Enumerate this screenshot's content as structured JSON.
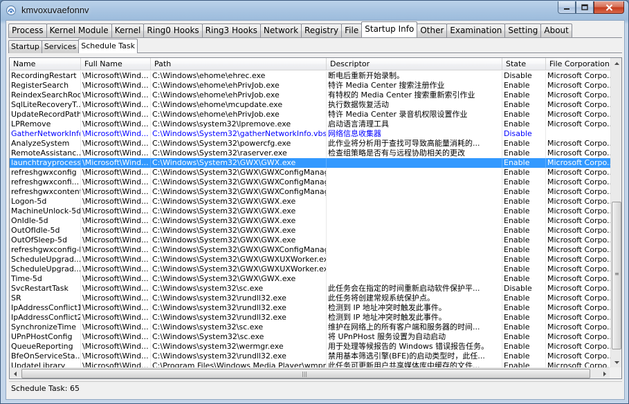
{
  "window": {
    "title": "kmvoxuvaefonnv"
  },
  "main_tabs": [
    {
      "label": "Process",
      "active": false
    },
    {
      "label": "Kernel Module",
      "active": false
    },
    {
      "label": "Kernel",
      "active": false
    },
    {
      "label": "Ring0 Hooks",
      "active": false
    },
    {
      "label": "Ring3 Hooks",
      "active": false
    },
    {
      "label": "Network",
      "active": false
    },
    {
      "label": "Registry",
      "active": false
    },
    {
      "label": "File",
      "active": false
    },
    {
      "label": "Startup Info",
      "active": true
    },
    {
      "label": "Other",
      "active": false
    },
    {
      "label": "Examination",
      "active": false
    },
    {
      "label": "Setting",
      "active": false
    },
    {
      "label": "About",
      "active": false
    }
  ],
  "sub_tabs": [
    {
      "label": "Startup",
      "active": false
    },
    {
      "label": "Services",
      "active": false
    },
    {
      "label": "Schedule Task",
      "active": true
    }
  ],
  "table": {
    "columns": [
      "Name",
      "Full Name",
      "Path",
      "Descriptor",
      "State",
      "File Corporation"
    ],
    "rows": [
      [
        "RecordingRestart",
        "\\Microsoft\\Wind...",
        "C:\\Windows\\ehome\\ehrec.exe",
        "断电后重新开始录制。",
        "Disable",
        "Microsoft Corpo..."
      ],
      [
        "RegisterSearch",
        "\\Microsoft\\Wind...",
        "C:\\Windows\\ehome\\ehPrivJob.exe",
        "特许 Media Center 搜索注册作业",
        "Enable",
        "Microsoft Corpo..."
      ],
      [
        "ReindexSearchRoot",
        "\\Microsoft\\Wind...",
        "C:\\Windows\\ehome\\ehPrivJob.exe",
        "有特权的 Media Center 搜索重新索引作业",
        "Enable",
        "Microsoft Corpo..."
      ],
      [
        "SqlLiteRecoveryT...",
        "\\Microsoft\\Wind...",
        "C:\\Windows\\ehome\\mcupdate.exe",
        "执行数据恢复活动",
        "Enable",
        "Microsoft Corpo..."
      ],
      [
        "UpdateRecordPath",
        "\\Microsoft\\Wind...",
        "C:\\Windows\\ehome\\ehPrivJob.exe",
        "特许 Media Center 录音机权限设置作业",
        "Enable",
        "Microsoft Corpo..."
      ],
      [
        "LPRemove",
        "\\Microsoft\\Wind...",
        "C:\\Windows\\system32\\lpremove.exe",
        "启动语言清理工具",
        "Enable",
        "Microsoft Corpo..."
      ],
      [
        "GatherNetworkInfo",
        "\\Microsoft\\Wind...",
        "C:\\Windows\\System32\\gatherNetworkInfo.vbs",
        "网络信息收集器",
        "Disable",
        ""
      ],
      [
        "AnalyzeSystem",
        "\\Microsoft\\Wind...",
        "C:\\Windows\\System32\\powercfg.exe",
        "此作业将分析用于查找可导致高能量消耗的...",
        "Enable",
        "Microsoft Corpo..."
      ],
      [
        "RemoteAssistanc...",
        "\\Microsoft\\Wind...",
        "C:\\Windows\\System32\\raserver.exe",
        "检查组策略是否有与远程协助相关的更改",
        "Enable",
        "Microsoft Corpo..."
      ],
      [
        "launchtrayprocess",
        "\\Microsoft\\Wind...",
        "C:\\Windows\\System32\\GWX\\GWX.exe",
        "",
        "Enable",
        "Microsoft Corpo..."
      ],
      [
        "refreshgwxconfig",
        "\\Microsoft\\Wind...",
        "C:\\Windows\\System32\\GWX\\GWXConfigManag...",
        "",
        "Enable",
        "Microsoft Corpo..."
      ],
      [
        "refreshgwxconfi...",
        "\\Microsoft\\Wind...",
        "C:\\Windows\\System32\\GWX\\GWXConfigManag...",
        "",
        "Enable",
        "Microsoft Corpo..."
      ],
      [
        "refreshgwxcontent",
        "\\Microsoft\\Wind...",
        "C:\\Windows\\System32\\GWX\\GWXConfigManag...",
        "",
        "Enable",
        "Microsoft Corpo..."
      ],
      [
        "Logon-5d",
        "\\Microsoft\\Wind...",
        "C:\\Windows\\System32\\GWX\\GWX.exe",
        "",
        "Enable",
        "Microsoft Corpo..."
      ],
      [
        "MachineUnlock-5d",
        "\\Microsoft\\Wind...",
        "C:\\Windows\\System32\\GWX\\GWX.exe",
        "",
        "Enable",
        "Microsoft Corpo..."
      ],
      [
        "OnIdle-5d",
        "\\Microsoft\\Wind...",
        "C:\\Windows\\System32\\GWX\\GWX.exe",
        "",
        "Enable",
        "Microsoft Corpo..."
      ],
      [
        "OutOfIdle-5d",
        "\\Microsoft\\Wind...",
        "C:\\Windows\\System32\\GWX\\GWX.exe",
        "",
        "Enable",
        "Microsoft Corpo..."
      ],
      [
        "OutOfSleep-5d",
        "\\Microsoft\\Wind...",
        "C:\\Windows\\System32\\GWX\\GWX.exe",
        "",
        "Enable",
        "Microsoft Corpo..."
      ],
      [
        "refreshgwxconfig-B",
        "\\Microsoft\\Wind...",
        "C:\\Windows\\System32\\GWX\\GWXConfigManag...",
        "",
        "Enable",
        "Microsoft Corpo..."
      ],
      [
        "ScheduleUpgrad...",
        "\\Microsoft\\Wind...",
        "C:\\Windows\\System32\\GWX\\GWXUXWorker.exe",
        "",
        "Enable",
        "Microsoft Corpo..."
      ],
      [
        "ScheduleUpgrad...",
        "\\Microsoft\\Wind...",
        "C:\\Windows\\System32\\GWX\\GWXUXWorker.exe",
        "",
        "Enable",
        "Microsoft Corpo..."
      ],
      [
        "Time-5d",
        "\\Microsoft\\Wind...",
        "C:\\Windows\\System32\\GWX\\GWX.exe",
        "",
        "Enable",
        "Microsoft Corpo..."
      ],
      [
        "SvcRestartTask",
        "\\Microsoft\\Wind...",
        "C:\\Windows\\system32\\sc.exe",
        "此任务会在指定的时间重新启动软件保护平...",
        "Disable",
        "Microsoft Corpo..."
      ],
      [
        "SR",
        "\\Microsoft\\Wind...",
        "C:\\Windows\\system32\\rundll32.exe",
        "此任务将创建常规系统保护点。",
        "Enable",
        "Microsoft Corpo..."
      ],
      [
        "IpAddressConflict1",
        "\\Microsoft\\Wind...",
        "C:\\Windows\\system32\\rundll32.exe",
        "检测到 IP 地址冲突时触发此事件。",
        "Enable",
        "Microsoft Corpo..."
      ],
      [
        "IpAddressConflict2",
        "\\Microsoft\\Wind...",
        "C:\\Windows\\system32\\rundll32.exe",
        "检测到 IP 地址冲突时触发此事件。",
        "Enable",
        "Microsoft Corpo..."
      ],
      [
        "SynchronizeTime",
        "\\Microsoft\\Wind...",
        "C:\\Windows\\system32\\sc.exe",
        "维护在网络上的所有客户端和服务器的时间...",
        "Enable",
        "Microsoft Corpo..."
      ],
      [
        "UPnPHostConfig",
        "\\Microsoft\\Wind...",
        "C:\\Windows\\System32\\sc.exe",
        "将 UPnPHost 服务设置为自动启动",
        "Enable",
        "Microsoft Corpo..."
      ],
      [
        "QueueReporting",
        "\\Microsoft\\Wind...",
        "C:\\Windows\\system32\\wermgr.exe",
        "用于处理等候报告的 Windows 错误报告任务。",
        "Enable",
        "Microsoft Corpo..."
      ],
      [
        "BfeOnServiceSta...",
        "\\Microsoft\\Wind...",
        "C:\\Windows\\system32\\rundll32.exe",
        "禁用基本筛选引擎(BFE)的启动类型时，此任...",
        "Enable",
        "Microsoft Corpo..."
      ],
      [
        "UpdateLibrary",
        "\\Microsoft\\Wind...",
        "C:\\Program Files\\Windows Media Player\\wmpns...",
        "此任务可更新用户共享媒体库中缓存的文件...",
        "Enable",
        "Microsoft Corpo..."
      ]
    ],
    "selected_row": 9,
    "highlight_row": 6
  },
  "status": {
    "text": "Schedule Task: 65"
  },
  "colors": {
    "selection": "#3399ff",
    "highlight_text": "#0000ff"
  }
}
